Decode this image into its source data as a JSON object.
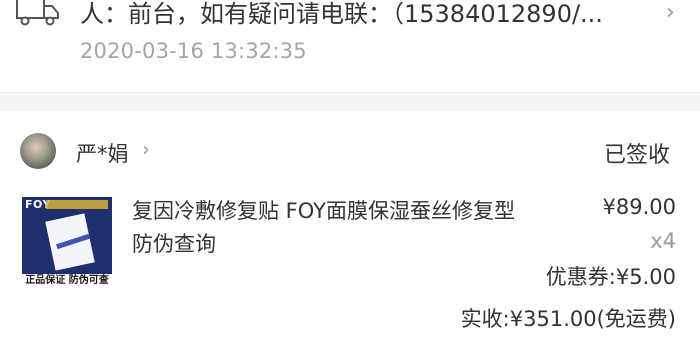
{
  "logistics": {
    "icon": "truck-icon",
    "text": "人：前台，如有疑问请电联：（15384012890/...",
    "time": "2020-03-16 13:32:35"
  },
  "order": {
    "buyer": {
      "name": "严*娟",
      "avatar": "avatar"
    },
    "status": "已签收",
    "product": {
      "title": "复因冷敷修复贴 FOY面膜保湿蚕丝修复型防伪查询",
      "image_brand": "FOY",
      "image_caption": "正品保证 防伪可查",
      "price": "¥89.00",
      "quantity": "x4"
    },
    "discount": "优惠券:¥5.00",
    "total": "实收:¥351.00(免运费)"
  }
}
